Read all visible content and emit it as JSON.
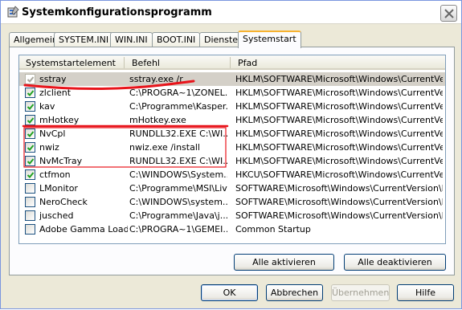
{
  "window": {
    "title": "Systemkonfigurationsprogramm",
    "icons": {
      "app": "msconfig-icon",
      "close": "close-icon"
    }
  },
  "tabs": [
    {
      "label": "Allgemein",
      "active": false
    },
    {
      "label": "SYSTEM.INI",
      "active": false
    },
    {
      "label": "WIN.INI",
      "active": false
    },
    {
      "label": "BOOT.INI",
      "active": false
    },
    {
      "label": "Dienste",
      "active": false
    },
    {
      "label": "Systemstart",
      "active": true
    }
  ],
  "list": {
    "columns": [
      "Systemstartelement",
      "Befehl",
      "Pfad"
    ],
    "rows": [
      {
        "checked": true,
        "disabled": true,
        "selected": true,
        "name": "sstray",
        "command": "sstray.exe /r",
        "path": "HKLM\\SOFTWARE\\Microsoft\\Windows\\CurrentVer..."
      },
      {
        "checked": true,
        "disabled": false,
        "selected": false,
        "name": "zlclient",
        "command": "C:\\PROGRA~1\\ZONEL...",
        "path": "HKLM\\SOFTWARE\\Microsoft\\Windows\\CurrentVer..."
      },
      {
        "checked": true,
        "disabled": false,
        "selected": false,
        "name": "kav",
        "command": "C:\\Programme\\Kasper...",
        "path": "HKLM\\SOFTWARE\\Microsoft\\Windows\\CurrentVer..."
      },
      {
        "checked": true,
        "disabled": false,
        "selected": false,
        "name": "mHotkey",
        "command": "mHotkey.exe",
        "path": "HKLM\\SOFTWARE\\Microsoft\\Windows\\CurrentVer..."
      },
      {
        "checked": true,
        "disabled": false,
        "selected": false,
        "name": "NvCpl",
        "command": "RUNDLL32.EXE C:\\WI...",
        "path": "HKLM\\SOFTWARE\\Microsoft\\Windows\\CurrentVer..."
      },
      {
        "checked": true,
        "disabled": false,
        "selected": false,
        "name": "nwiz",
        "command": "nwiz.exe /install",
        "path": "HKLM\\SOFTWARE\\Microsoft\\Windows\\CurrentVer..."
      },
      {
        "checked": true,
        "disabled": false,
        "selected": false,
        "name": "NvMcTray",
        "command": "RUNDLL32.EXE C:\\WI...",
        "path": "HKLM\\SOFTWARE\\Microsoft\\Windows\\CurrentVer..."
      },
      {
        "checked": true,
        "disabled": false,
        "selected": false,
        "name": "ctfmon",
        "command": "C:\\WINDOWS\\System...",
        "path": "HKCU\\SOFTWARE\\Microsoft\\Windows\\CurrentVer..."
      },
      {
        "checked": false,
        "disabled": false,
        "selected": false,
        "name": "LMonitor",
        "command": "C:\\Programme\\MSI\\Liv...",
        "path": "SOFTWARE\\Microsoft\\Windows\\CurrentVersion\\Run"
      },
      {
        "checked": false,
        "disabled": false,
        "selected": false,
        "name": "NeroCheck",
        "command": "C:\\WINDOWS\\system...",
        "path": "SOFTWARE\\Microsoft\\Windows\\CurrentVersion\\Run"
      },
      {
        "checked": false,
        "disabled": false,
        "selected": false,
        "name": "jusched",
        "command": "C:\\Programme\\Java\\j...",
        "path": "SOFTWARE\\Microsoft\\Windows\\CurrentVersion\\Run"
      },
      {
        "checked": false,
        "disabled": false,
        "selected": false,
        "name": "Adobe Gamma Loader",
        "command": "C:\\PROGRA~1\\GEMEI...",
        "path": "Common Startup"
      }
    ]
  },
  "panel_buttons": {
    "enable_all": "Alle aktivieren",
    "disable_all": "Alle deaktivieren"
  },
  "dialog_buttons": {
    "ok": "OK",
    "cancel": "Abbrechen",
    "apply": "Übernehmen",
    "help": "Hilfe"
  },
  "colors": {
    "annotation": "#e8141b"
  }
}
